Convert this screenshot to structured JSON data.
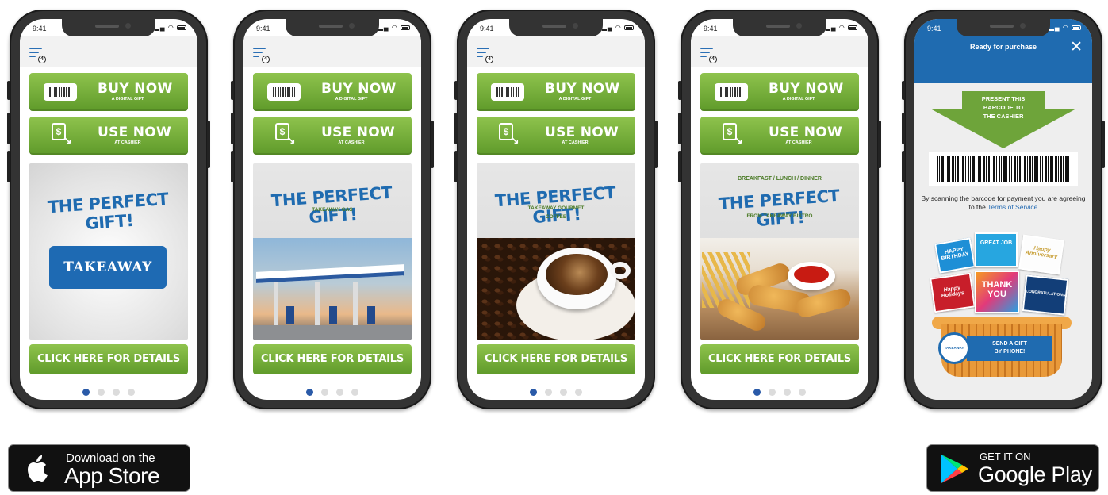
{
  "status_time": "9:41",
  "menu_badge": "4",
  "buy_button": {
    "title": "BUY NOW",
    "subtitle": "A DIGITAL GIFT"
  },
  "use_button": {
    "title": "USE NOW",
    "subtitle": "AT CASHIER"
  },
  "promo_title": "THE PERFECT GIFT!",
  "details_button": "CLICK HERE FOR DETAILS",
  "carousel_dot_count": 4,
  "carousel_active_index": 0,
  "phones": [
    {
      "logo_text": "TAKEAWAY"
    },
    {
      "subtitle": "TAKEAWAY GAS"
    },
    {
      "subtitle_line1": "TAKEAWAY GOURMET",
      "subtitle_line2": "COFFEE"
    },
    {
      "pretitle": "BREAKFAST / LUNCH / DINNER",
      "subtitle": "FROM TAKEAWAY BISTRO"
    }
  ],
  "purchase": {
    "title": "Ready for purchase",
    "close_icon": "close-icon",
    "arrow_line1": "PRESENT THIS",
    "arrow_line2": "BARCODE TO",
    "arrow_line3": "THE CASHIER",
    "legal_text": "By scanning the barcode for payment you are agreeing to the ",
    "legal_link": "Terms of Service",
    "cards": {
      "happy_birthday_1": "HAPPY",
      "happy_birthday_2": "BIRTHDAY",
      "great_job": "GREAT JOB",
      "happy_anniv": "Happy Anniversary",
      "happy_holidays": "Happy Holidays",
      "thank_you_1": "THANK",
      "thank_you_2": "YOU",
      "congrats": "CONGRATULATIONS!"
    },
    "basket_line1": "SEND A GIFT",
    "basket_line2": "BY PHONE!",
    "basket_tag": "TAKEAWAY"
  },
  "app_store": {
    "line1": "Download on the",
    "line2": "App Store"
  },
  "google_play": {
    "line1": "GET IT ON",
    "line2": "Google Play"
  },
  "colors": {
    "green": "#6ea43a",
    "blue": "#1f6bb0",
    "dot_active": "#2a5aa8"
  }
}
